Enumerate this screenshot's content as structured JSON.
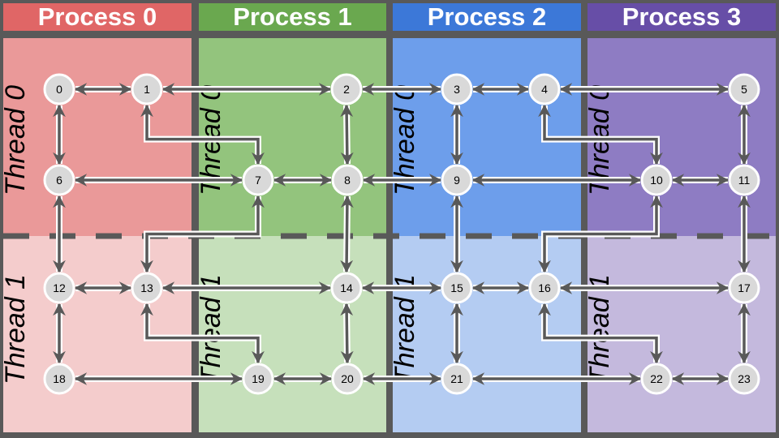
{
  "processes": [
    {
      "label": "Process 0",
      "header_color": "#e06666",
      "top_color": "#ea9999",
      "bottom_color": "#f4cccc"
    },
    {
      "label": "Process 1",
      "header_color": "#6aa84f",
      "top_color": "#93c47d",
      "bottom_color": "#c6e0bb"
    },
    {
      "label": "Process 2",
      "header_color": "#3c78d8",
      "top_color": "#6d9eeb",
      "bottom_color": "#b4ccf2"
    },
    {
      "label": "Process 3",
      "header_color": "#674ea7",
      "top_color": "#8e7cc3",
      "bottom_color": "#c4b9dd"
    }
  ],
  "thread_labels": [
    "Thread 0",
    "Thread 1"
  ],
  "nodes": [
    {
      "id": "0",
      "col": 0,
      "row": 0
    },
    {
      "id": "1",
      "col": 1,
      "row": 0
    },
    {
      "id": "2",
      "col": 2,
      "row": 0
    },
    {
      "id": "3",
      "col": 3,
      "row": 0
    },
    {
      "id": "4",
      "col": 4,
      "row": 0
    },
    {
      "id": "5",
      "col": 5,
      "row": 0
    },
    {
      "id": "6",
      "col": 0,
      "row": 1
    },
    {
      "id": "7",
      "col": 1,
      "row": 1
    },
    {
      "id": "8",
      "col": 2,
      "row": 1
    },
    {
      "id": "9",
      "col": 3,
      "row": 1
    },
    {
      "id": "10",
      "col": 4,
      "row": 1
    },
    {
      "id": "11",
      "col": 5,
      "row": 1
    },
    {
      "id": "12",
      "col": 0,
      "row": 2
    },
    {
      "id": "13",
      "col": 1,
      "row": 2
    },
    {
      "id": "14",
      "col": 2,
      "row": 2
    },
    {
      "id": "15",
      "col": 3,
      "row": 2
    },
    {
      "id": "16",
      "col": 4,
      "row": 2
    },
    {
      "id": "17",
      "col": 5,
      "row": 2
    },
    {
      "id": "18",
      "col": 0,
      "row": 3
    },
    {
      "id": "19",
      "col": 1,
      "row": 3
    },
    {
      "id": "20",
      "col": 2,
      "row": 3
    },
    {
      "id": "21",
      "col": 3,
      "row": 3
    },
    {
      "id": "22",
      "col": 4,
      "row": 3
    },
    {
      "id": "23",
      "col": 5,
      "row": 3
    }
  ],
  "edges": [
    [
      "0",
      "1"
    ],
    [
      "1",
      "2"
    ],
    [
      "2",
      "3"
    ],
    [
      "3",
      "4"
    ],
    [
      "4",
      "5"
    ],
    [
      "6",
      "7"
    ],
    [
      "7",
      "8"
    ],
    [
      "8",
      "9"
    ],
    [
      "9",
      "10"
    ],
    [
      "10",
      "11"
    ],
    [
      "12",
      "13"
    ],
    [
      "13",
      "14"
    ],
    [
      "14",
      "15"
    ],
    [
      "15",
      "16"
    ],
    [
      "16",
      "17"
    ],
    [
      "18",
      "19"
    ],
    [
      "19",
      "20"
    ],
    [
      "20",
      "21"
    ],
    [
      "21",
      "22"
    ],
    [
      "22",
      "23"
    ],
    [
      "0",
      "6"
    ],
    [
      "2",
      "8"
    ],
    [
      "3",
      "9"
    ],
    [
      "5",
      "11"
    ],
    [
      "6",
      "12"
    ],
    [
      "8",
      "14"
    ],
    [
      "9",
      "15"
    ],
    [
      "11",
      "17"
    ],
    [
      "12",
      "18"
    ],
    [
      "14",
      "20"
    ],
    [
      "15",
      "21"
    ],
    [
      "17",
      "23"
    ],
    [
      "1",
      "7"
    ],
    [
      "7",
      "13"
    ],
    [
      "13",
      "19"
    ],
    [
      "4",
      "10"
    ],
    [
      "10",
      "16"
    ],
    [
      "16",
      "22"
    ]
  ],
  "colors": {
    "background": "#595959",
    "node_fill": "#d9d9d9",
    "node_stroke": "#ffffff",
    "edge": "#595959"
  }
}
